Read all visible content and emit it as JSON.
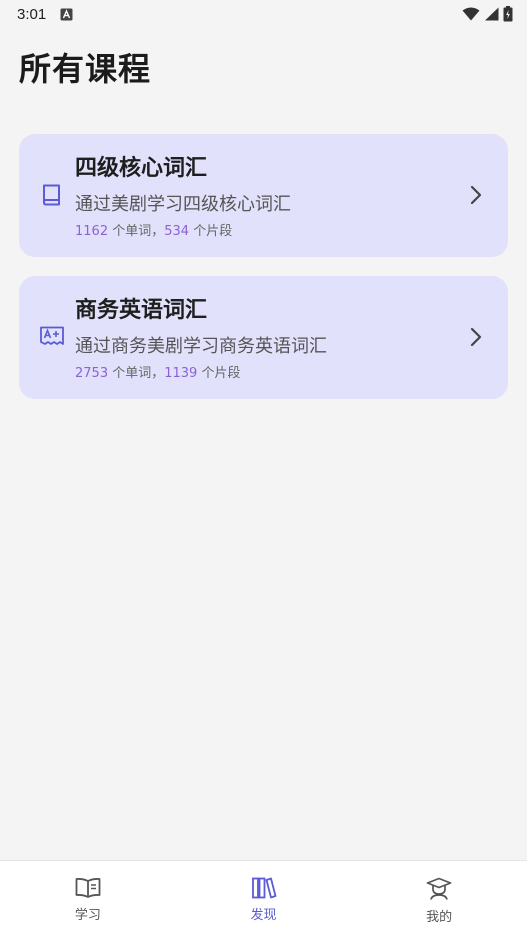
{
  "status_bar": {
    "time": "3:01",
    "icons": [
      "keyboard-a-icon",
      "wifi-icon",
      "signal-icon",
      "battery-icon"
    ]
  },
  "page": {
    "title": "所有课程"
  },
  "courses": [
    {
      "name": "四级核心词汇",
      "description": "通过美剧学习四级核心词汇",
      "word_count": "1162",
      "word_unit": " 个单词，",
      "clip_count": "534",
      "clip_unit": " 个片段",
      "icon": "book-icon"
    },
    {
      "name": "商务英语词汇",
      "description": "通过商务美剧学习商务英语词汇",
      "word_count": "2753",
      "word_unit": " 个单词，",
      "clip_count": "1139",
      "clip_unit": " 个片段",
      "icon": "grade-a-plus-icon"
    }
  ],
  "bottom_nav": {
    "items": [
      {
        "label": "学习",
        "icon": "open-book-icon",
        "active": false
      },
      {
        "label": "发现",
        "icon": "books-icon",
        "active": true
      },
      {
        "label": "我的",
        "icon": "graduate-icon",
        "active": false
      }
    ]
  },
  "colors": {
    "accent": "#5b5bd6",
    "card_background": "#e2e1fb",
    "stat_number": "#8a63d2",
    "page_background": "#f4f4f4"
  }
}
